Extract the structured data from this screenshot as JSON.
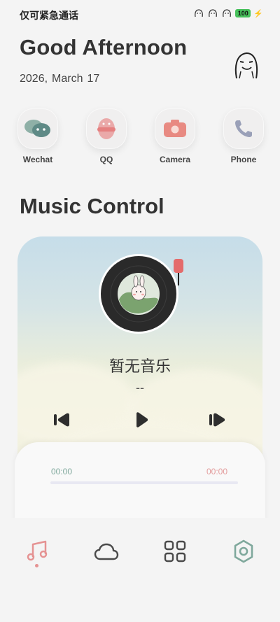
{
  "status_bar": {
    "carrier": "仅可紧急通话",
    "battery": "100"
  },
  "header": {
    "greeting": "Good Afternoon",
    "date": {
      "year": "2026,",
      "month": "March",
      "day": "17"
    },
    "mascot_icon": "doodle-face-icon"
  },
  "apps": [
    {
      "label": "Wechat",
      "icon": "wechat-icon"
    },
    {
      "label": "QQ",
      "icon": "qq-icon"
    },
    {
      "label": "Camera",
      "icon": "camera-icon"
    },
    {
      "label": "Phone",
      "icon": "phone-icon"
    }
  ],
  "music": {
    "section_title": "Music Control",
    "song_title": "暂无音乐",
    "artist": "--",
    "time_current": "00:00",
    "time_total": "00:00",
    "progress": 0
  },
  "nav": [
    {
      "name": "music",
      "icon": "music-note-icon",
      "active": true
    },
    {
      "name": "weather",
      "icon": "cloud-icon",
      "active": false
    },
    {
      "name": "apps",
      "icon": "grid-icon",
      "active": false
    },
    {
      "name": "settings",
      "icon": "settings-icon",
      "active": false
    }
  ],
  "colors": {
    "accent_pink": "#e59393",
    "accent_green": "#7fa89c",
    "text_dark": "#333333"
  }
}
